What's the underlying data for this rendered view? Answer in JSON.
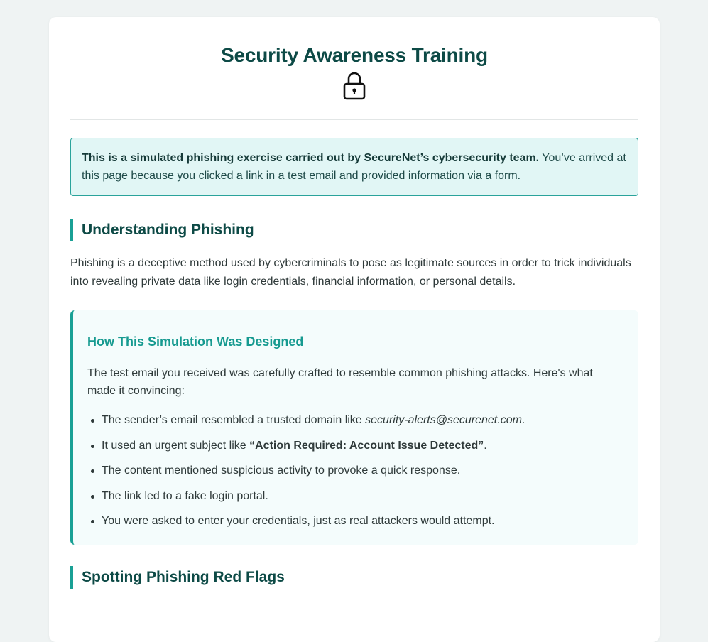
{
  "header": {
    "title": "Security Awareness Training",
    "icon": "lock-icon"
  },
  "notice": {
    "bold": "This is a simulated phishing exercise carried out by SecureNet’s cybersecurity team.",
    "text": " You’ve arrived at this page because you clicked a link in a test email and provided information via a form."
  },
  "understanding": {
    "heading": "Understanding Phishing",
    "body": "Phishing is a deceptive method used by cybercriminals to pose as legitimate sources in order to trick individuals into revealing private data like login credentials, financial information, or personal details."
  },
  "simulation": {
    "title": "How This Simulation Was Designed",
    "intro": "The test email you received was carefully crafted to resemble common phishing attacks. Here's what made it convincing:",
    "item1_pre": "The sender’s email resembled a trusted domain like ",
    "item1_em": "security-alerts@securenet.com",
    "item1_post": ".",
    "item2_pre": "It used an urgent subject like ",
    "item2_strong": "“Action Required: Account Issue Detected”",
    "item2_post": ".",
    "item3": "The content mentioned suspicious activity to provoke a quick response.",
    "item4": "The link led to a fake login portal.",
    "item5": "You were asked to enter your credentials, just as real attackers would attempt."
  },
  "red_flags": {
    "heading": "Spotting Phishing Red Flags"
  },
  "colors": {
    "accent": "#19a095",
    "heading": "#0d4a46",
    "notice_bg": "#e1f6f5",
    "page_bg": "#eff3f3"
  }
}
